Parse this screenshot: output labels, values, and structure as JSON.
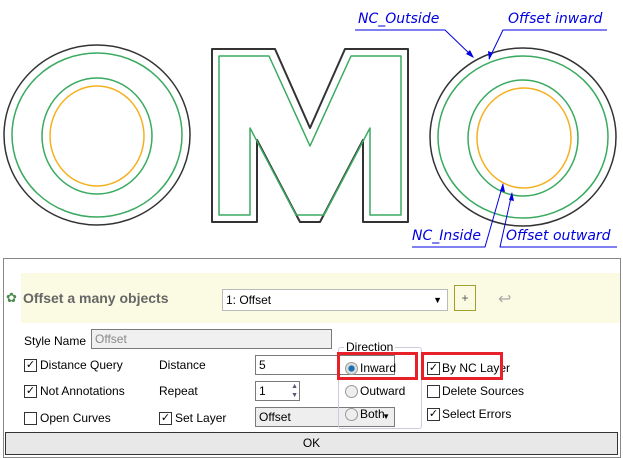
{
  "drawing": {
    "labels": {
      "nc_outside": "NC_Outside",
      "offset_inward": "Offset inward",
      "nc_inside": "NC_Inside",
      "offset_outward": "Offset outward"
    },
    "colors": {
      "source": "#333333",
      "offset": "#3aaa60",
      "inside": "#f5b020",
      "leader": "#0000e0"
    }
  },
  "dialog": {
    "title": "Offset a many objects",
    "style_select": "1: Offset",
    "add_button": "+",
    "style_name_label": "Style Name",
    "style_name_value": "Offset",
    "distance_query": {
      "label": "Distance Query",
      "checked": true
    },
    "not_annotations": {
      "label": "Not Annotations",
      "checked": true
    },
    "open_curves": {
      "label": "Open Curves",
      "checked": false
    },
    "distance_label": "Distance",
    "distance_value": "5",
    "repeat_label": "Repeat",
    "repeat_value": "1",
    "set_layer": {
      "label": "Set Layer",
      "checked": true
    },
    "layer_value": "Offset",
    "direction": {
      "legend": "Direction",
      "options": [
        "Inward",
        "Outward",
        "Both"
      ],
      "selected": "Inward"
    },
    "by_nc_layer": {
      "label": "By NC Layer",
      "checked": true
    },
    "delete_sources": {
      "label": "Delete Sources",
      "checked": false
    },
    "select_errors": {
      "label": "Select Errors",
      "checked": true
    },
    "ok": "OK",
    "check_mark": "✓"
  }
}
